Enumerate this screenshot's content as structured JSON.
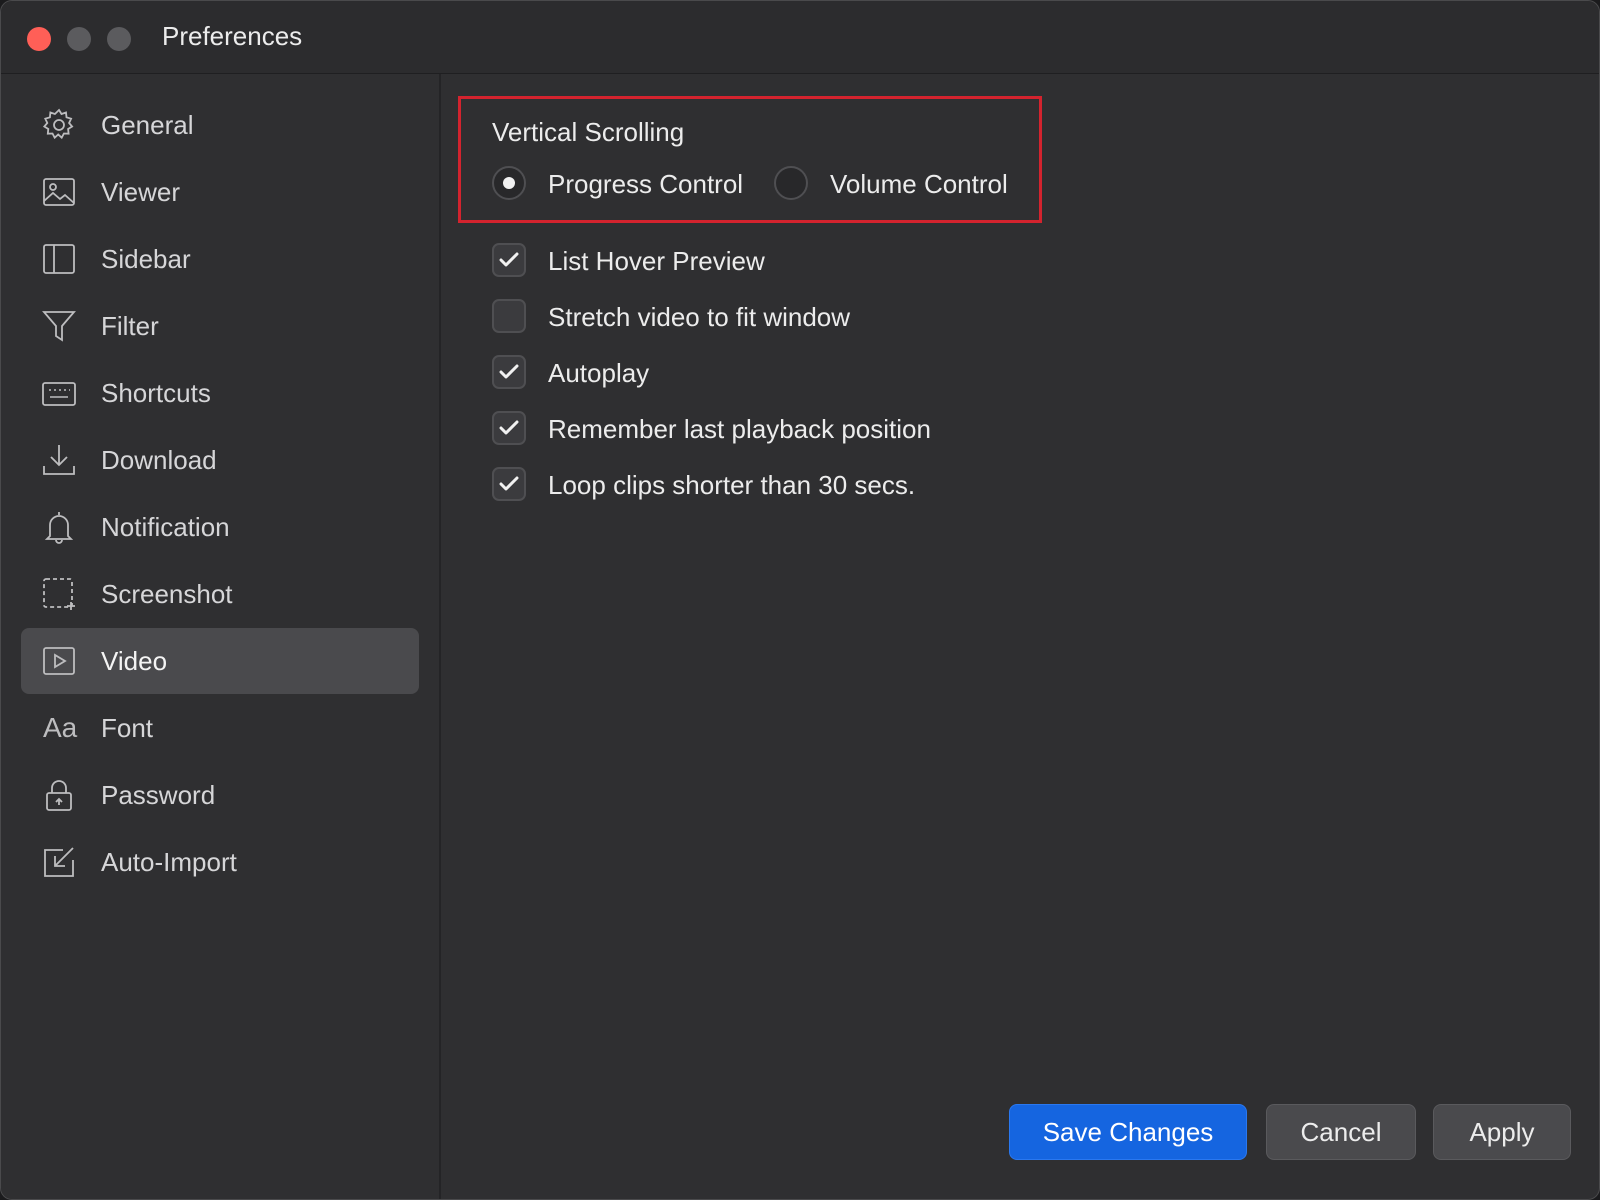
{
  "window": {
    "title": "Preferences"
  },
  "sidebar": {
    "items": [
      {
        "label": "General",
        "icon": "gear-icon"
      },
      {
        "label": "Viewer",
        "icon": "image-icon"
      },
      {
        "label": "Sidebar",
        "icon": "sidebar-icon"
      },
      {
        "label": "Filter",
        "icon": "funnel-icon"
      },
      {
        "label": "Shortcuts",
        "icon": "keyboard-icon"
      },
      {
        "label": "Download",
        "icon": "download-icon"
      },
      {
        "label": "Notification",
        "icon": "bell-icon"
      },
      {
        "label": "Screenshot",
        "icon": "screenshot-icon"
      },
      {
        "label": "Video",
        "icon": "video-icon",
        "selected": true
      },
      {
        "label": "Font",
        "icon": "font-icon",
        "glyph": "Aa"
      },
      {
        "label": "Password",
        "icon": "lock-icon"
      },
      {
        "label": "Auto-Import",
        "icon": "import-icon"
      }
    ]
  },
  "video_settings": {
    "vertical_scrolling": {
      "title": "Vertical Scrolling",
      "options": [
        {
          "label": "Progress Control",
          "selected": true
        },
        {
          "label": "Volume Control",
          "selected": false
        }
      ]
    },
    "checkboxes": [
      {
        "label": "List Hover Preview",
        "checked": true
      },
      {
        "label": "Stretch video to fit window",
        "checked": false
      },
      {
        "label": "Autoplay",
        "checked": true
      },
      {
        "label": "Remember last playback position",
        "checked": true
      },
      {
        "label": "Loop clips shorter than 30 secs.",
        "checked": true
      }
    ]
  },
  "buttons": {
    "save": "Save Changes",
    "cancel": "Cancel",
    "apply": "Apply"
  },
  "colors": {
    "accent": "#1565e0",
    "highlight_border": "#d3232e",
    "close": "#ff5f57"
  }
}
